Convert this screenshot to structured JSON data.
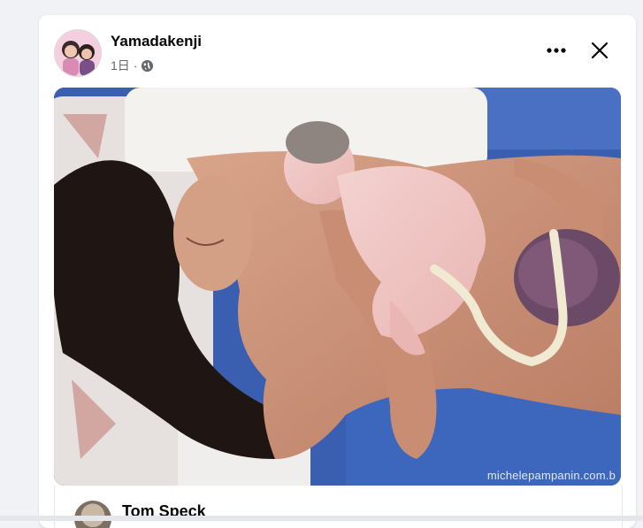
{
  "post": {
    "author": "Yamadakenji",
    "time": "1日",
    "separator": "·",
    "privacy_icon": "globe-icon",
    "more_icon": "more-options-icon",
    "close_icon": "close-icon",
    "watermark": "michelepampanin.com.b"
  },
  "comment": {
    "author": "Tom Speck"
  },
  "colors": {
    "card_bg": "#ffffff",
    "page_bg": "#f0f2f5",
    "text_primary": "#050505",
    "text_secondary": "#65676b",
    "towel_blue": "#3a5fb0"
  }
}
